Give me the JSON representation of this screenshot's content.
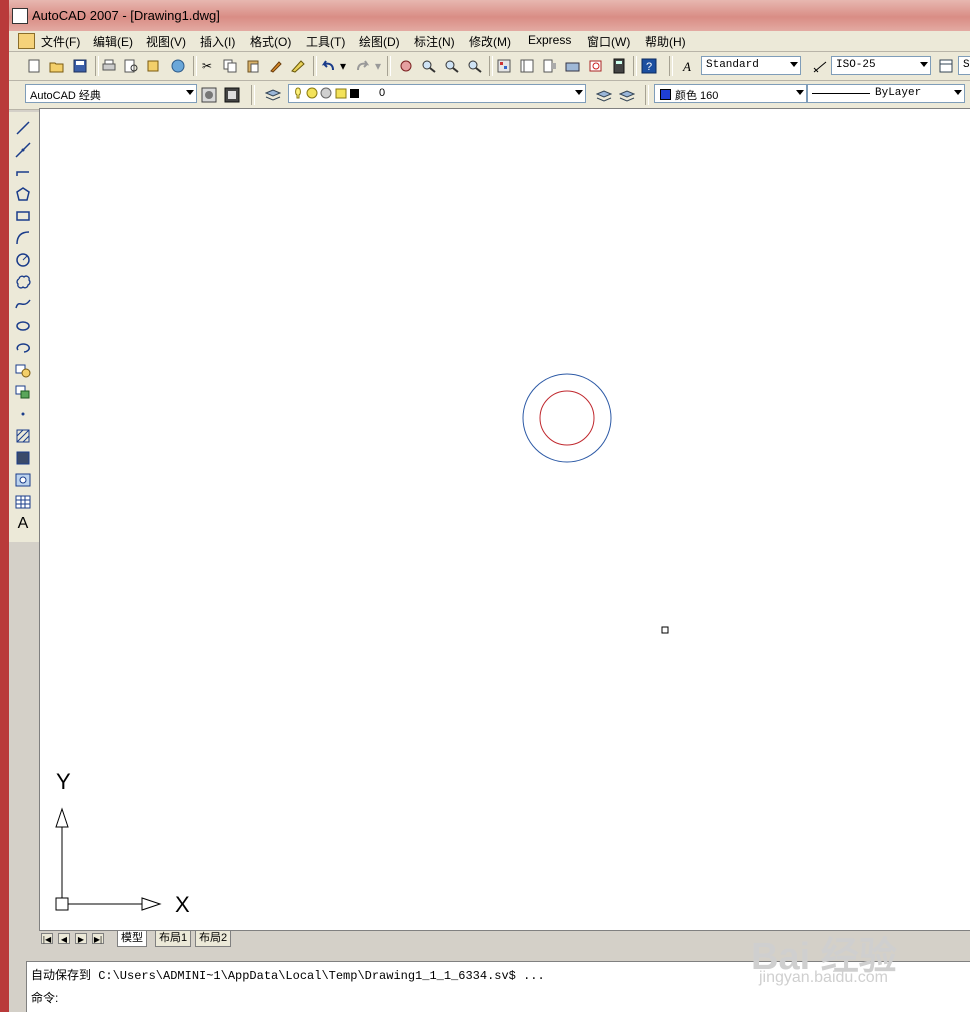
{
  "window": {
    "title": "AutoCAD 2007 - [Drawing1.dwg]"
  },
  "menu": [
    "文件(F)",
    "编辑(E)",
    "视图(V)",
    "插入(I)",
    "格式(O)",
    "工具(T)",
    "绘图(D)",
    "标注(N)",
    "修改(M)",
    "Express",
    "窗口(W)",
    "帮助(H)"
  ],
  "toolbar": {
    "text_style": "Standard",
    "dim_style": "ISO-25",
    "table_style_partial": "S"
  },
  "properties": {
    "workspace": "AutoCAD 经典",
    "layer": "0",
    "color": "颜色 160",
    "color_swatch": "#1f3fd6",
    "linetype": "ByLayer"
  },
  "drawing": {
    "outer_circle_color": "#2d5aa6",
    "inner_circle_color": "#c0282e",
    "ucs_x_label": "X",
    "ucs_y_label": "Y"
  },
  "tabs": [
    "模型",
    "布局1",
    "布局2"
  ],
  "command": {
    "line1": "自动保存到 C:\\Users\\ADMINI~1\\AppData\\Local\\Temp\\Drawing1_1_1_6334.sv$ ...",
    "prompt": "命令:"
  },
  "watermark": {
    "brand": "Bai 经验",
    "url": "jingyan.baidu.com"
  }
}
